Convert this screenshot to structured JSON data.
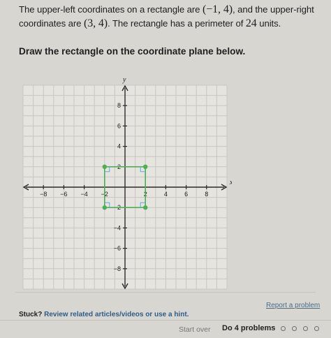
{
  "problem": {
    "line1_prefix": "The upper-left coordinates on a rectangle are ",
    "upper_left": "(−1, 4)",
    "line1_suffix": ", and the upper-right",
    "line2_prefix": "coordinates are ",
    "upper_right": "(3, 4)",
    "line2_mid": ". The rectangle has a perimeter of ",
    "perimeter": "24",
    "line2_suffix": " units."
  },
  "instruction": "Draw the rectangle on the coordinate plane below.",
  "graph": {
    "x_axis_label": "x",
    "y_axis_label": "y",
    "x_ticks": [
      "−8",
      "−6",
      "−4",
      "−2",
      "2",
      "4",
      "6",
      "8"
    ],
    "y_ticks": [
      "8",
      "6",
      "4",
      "2",
      "−2",
      "−4",
      "−6",
      "−8"
    ],
    "x_range": [
      -10,
      10
    ],
    "y_range": [
      -10,
      10
    ],
    "rectangle": {
      "x1": -2,
      "y1": 2,
      "x2": 2,
      "y2": -2
    },
    "colors": {
      "rectangle": "#4caf50",
      "handle": "#5aa9e6",
      "grid": "#c8c6c0",
      "axis": "#2a2a2a"
    }
  },
  "footer": {
    "stuck_label": "Stuck?",
    "hint_link": "Review related articles/videos or use a hint.",
    "report_link": "Report a problem",
    "start_over": "Start over",
    "do_problems": "Do 4 problems"
  }
}
